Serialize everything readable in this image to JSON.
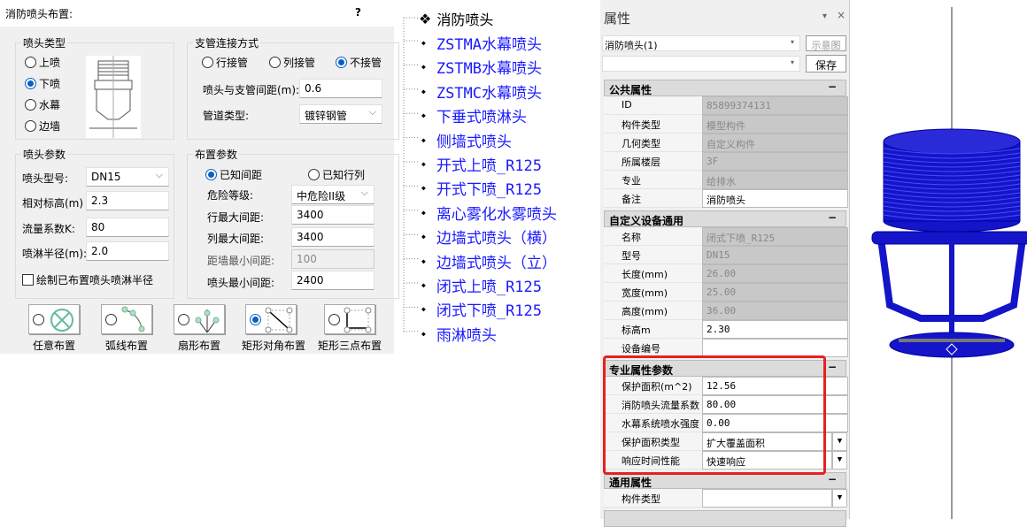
{
  "dialog": {
    "title": "消防喷头布置:",
    "help": "?",
    "type_group": {
      "title": "喷头类型",
      "options": [
        "上喷",
        "下喷",
        "水幕",
        "边墙"
      ],
      "selected": "下喷"
    },
    "branch_group": {
      "title": "支管连接方式",
      "options": [
        "行接管",
        "列接管",
        "不接管"
      ],
      "selected": "不接管",
      "spacing_label": "喷头与支管间距(m):",
      "spacing_value": "0.6",
      "pipe_type_label": "管道类型:",
      "pipe_type_value": "镀锌钢管"
    },
    "params_group": {
      "title": "喷头参数",
      "model_label": "喷头型号:",
      "model_value": "DN15",
      "elev_label": "相对标高(m)",
      "elev_value": "2.3",
      "k_label": "流量系数K:",
      "k_value": "80",
      "radius_label": "喷淋半径(m):",
      "radius_value": "2.0",
      "draw_radius_label": "绘制已布置喷头喷淋半径"
    },
    "layout_group": {
      "title": "布置参数",
      "options": [
        "已知间距",
        "已知行列"
      ],
      "selected": "已知间距",
      "hazard_label": "危险等级:",
      "hazard_value": "中危险II级",
      "row_max_label": "行最大间距:",
      "row_max_value": "3400",
      "col_max_label": "列最大间距:",
      "col_max_value": "3400",
      "wall_min_label": "距墙最小间距:",
      "wall_min_value": "100",
      "head_min_label": "喷头最小间距:",
      "head_min_value": "2400"
    },
    "layout_modes": [
      "任意布置",
      "弧线布置",
      "扇形布置",
      "矩形对角布置",
      "矩形三点布置"
    ],
    "layout_mode_selected": "矩形对角布置"
  },
  "tree": {
    "root": "消防喷头",
    "items": [
      "ZSTMA水幕喷头",
      "ZSTMB水幕喷头",
      "ZSTMC水幕喷头",
      "下垂式喷淋头",
      "侧墙式喷头",
      "开式上喷_R125",
      "开式下喷_R125",
      "离心雾化水雾喷头",
      "边墙式喷头（横）",
      "边墙式喷头（立）",
      "闭式上喷_R125",
      "闭式下喷_R125",
      "雨淋喷头"
    ]
  },
  "props": {
    "title": "属性",
    "pin": "▾",
    "close": "×",
    "selector": "消防喷头(1)",
    "diagram_btn": "示意图",
    "save_btn": "保存",
    "sections": [
      {
        "title": "公共属性",
        "rows": [
          [
            "ID",
            "85899374131",
            "ro"
          ],
          [
            "构件类型",
            "模型构件",
            "ro"
          ],
          [
            "几何类型",
            "自定义构件",
            "ro"
          ],
          [
            "所属楼层",
            "3F",
            "ro"
          ],
          [
            "专业",
            "给排水",
            "ro"
          ],
          [
            "备注",
            "消防喷头",
            "ed"
          ]
        ]
      },
      {
        "title": "自定义设备通用",
        "rows": [
          [
            "名称",
            "闭式下喷_R125",
            "ro"
          ],
          [
            "型号",
            "DN15",
            "ro"
          ],
          [
            "长度(mm)",
            "26.00",
            "ro"
          ],
          [
            "宽度(mm)",
            "25.00",
            "ro"
          ],
          [
            "高度(mm)",
            "36.00",
            "ro"
          ],
          [
            "标高m",
            "2.30",
            "ed"
          ],
          [
            "设备编号",
            "",
            "ed"
          ]
        ]
      },
      {
        "title": "专业属性参数",
        "rows": [
          [
            "保护面积(m^2)",
            "12.56",
            "ed"
          ],
          [
            "消防喷头流量系数",
            "80.00",
            "ed"
          ],
          [
            "水幕系统喷水强度(",
            "0.00",
            "ed"
          ],
          [
            "保护面积类型",
            "扩大覆盖面积",
            "dd"
          ],
          [
            "响应时间性能",
            "快速响应",
            "dd"
          ]
        ]
      },
      {
        "title": "通用属性",
        "rows": [
          [
            "构件类型",
            "",
            "dd"
          ]
        ]
      }
    ]
  },
  "colors": {
    "model": "#1010c8",
    "highlight": "#e82020",
    "link": "#1a1aff"
  }
}
